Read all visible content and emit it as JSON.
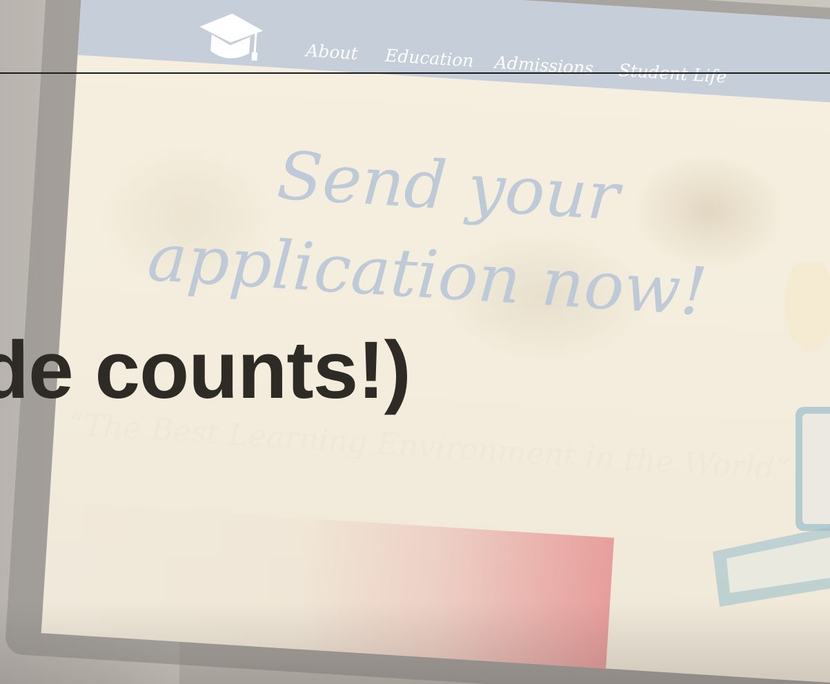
{
  "nav": {
    "items": [
      {
        "label": "About"
      },
      {
        "label": "Education"
      },
      {
        "label": "Admissions"
      },
      {
        "label": "Student Life"
      }
    ]
  },
  "logo": {
    "icon": "graduation-cap-icon"
  },
  "hero": {
    "line1": "Send your",
    "line2": "application now!"
  },
  "tagline": "“The Best Learning Environment in the World”",
  "overlay": {
    "heading": "de counts!)"
  },
  "colors": {
    "navbar": "#c6cfd9",
    "hero_text": "#b9c7d8",
    "overlay_heading": "#2e2b27"
  }
}
